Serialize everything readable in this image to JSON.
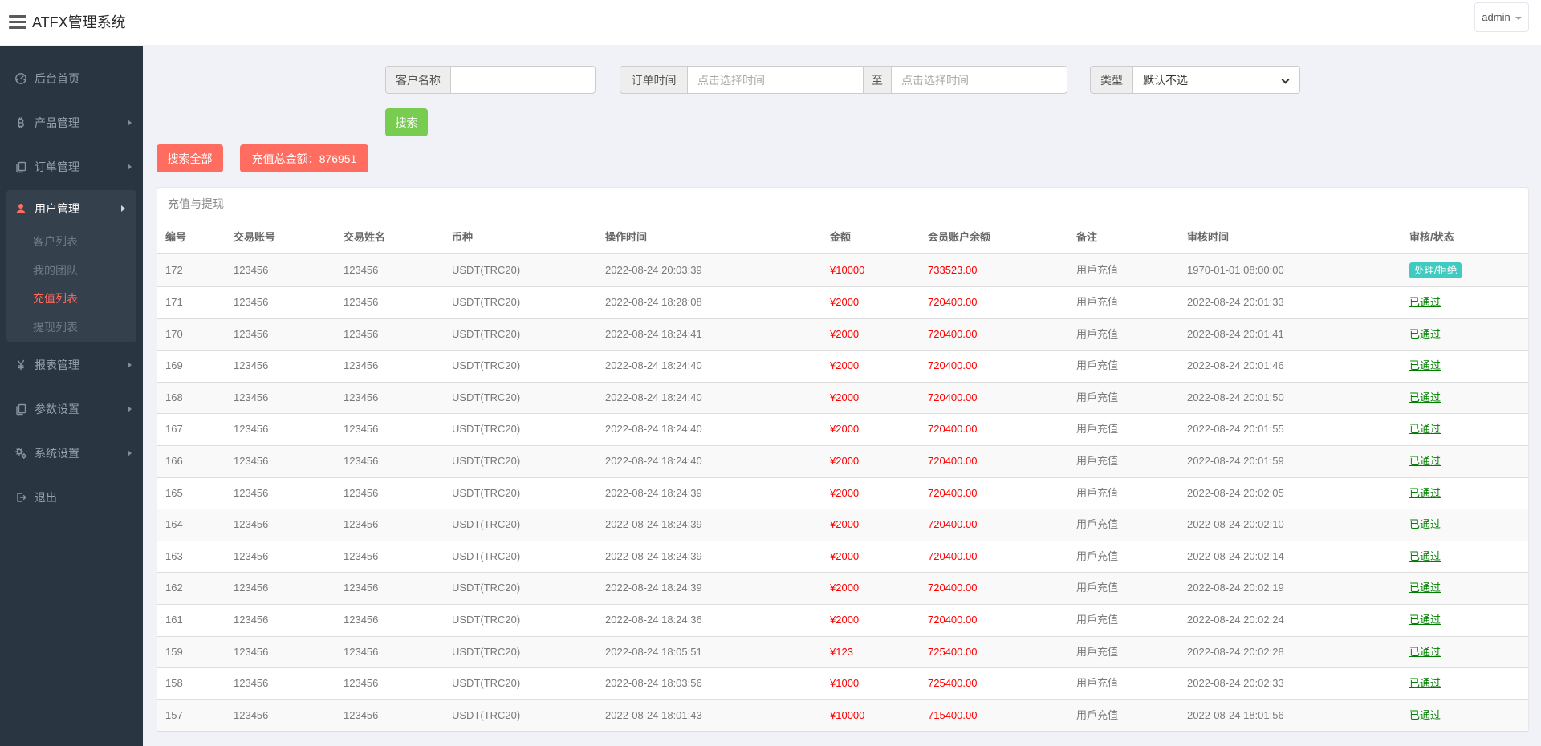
{
  "header": {
    "title": "ATFX管理系统",
    "user_menu": "admin"
  },
  "sidebar": {
    "items": [
      {
        "key": "home",
        "label": "后台首页",
        "icon": "dashboard-icon",
        "arrow": false
      },
      {
        "key": "products",
        "label": "产品管理",
        "icon": "bitcoin-icon",
        "arrow": true
      },
      {
        "key": "orders",
        "label": "订单管理",
        "icon": "orders-icon",
        "arrow": true
      },
      {
        "key": "users",
        "label": "用户管理",
        "icon": "user-icon",
        "arrow": true,
        "active": true,
        "children": [
          {
            "key": "customer-list",
            "label": "客户列表",
            "active": false
          },
          {
            "key": "my-team",
            "label": "我的团队",
            "active": false
          },
          {
            "key": "recharge-list",
            "label": "充值列表",
            "active": true
          },
          {
            "key": "withdraw-list",
            "label": "提现列表",
            "active": false
          }
        ]
      },
      {
        "key": "reports",
        "label": "报表管理",
        "icon": "yen-icon",
        "arrow": true
      },
      {
        "key": "params",
        "label": "参数设置",
        "icon": "params-icon",
        "arrow": true
      },
      {
        "key": "system",
        "label": "系统设置",
        "icon": "gears-icon",
        "arrow": true
      },
      {
        "key": "logout",
        "label": "退出",
        "icon": "logout-icon",
        "arrow": false
      }
    ]
  },
  "filters": {
    "customer_label": "客户名称",
    "order_time_label": "订单时间",
    "time_placeholder": "点击选择时间",
    "to_label": "至",
    "type_label": "类型",
    "type_value": "默认不选",
    "search_button": "搜索",
    "search_all_button": "搜索全部",
    "total_button": "充值总金额：876951"
  },
  "table": {
    "card_title": "充值与提现",
    "columns": [
      "编号",
      "交易账号",
      "交易姓名",
      "币种",
      "操作时间",
      "金额",
      "会员账户余额",
      "备注",
      "审核时间",
      "审核/状态"
    ],
    "pending_label": "处理/拒绝",
    "approved_label": "已通过",
    "rows": [
      [
        "172",
        "123456",
        "123456",
        "USDT(TRC20)",
        "2022-08-24 20:03:39",
        "¥10000",
        "733523.00",
        "用戶充值",
        "1970-01-01 08:00:00",
        "pending"
      ],
      [
        "171",
        "123456",
        "123456",
        "USDT(TRC20)",
        "2022-08-24 18:28:08",
        "¥2000",
        "720400.00",
        "用戶充值",
        "2022-08-24 20:01:33",
        "approved"
      ],
      [
        "170",
        "123456",
        "123456",
        "USDT(TRC20)",
        "2022-08-24 18:24:41",
        "¥2000",
        "720400.00",
        "用戶充值",
        "2022-08-24 20:01:41",
        "approved"
      ],
      [
        "169",
        "123456",
        "123456",
        "USDT(TRC20)",
        "2022-08-24 18:24:40",
        "¥2000",
        "720400.00",
        "用戶充值",
        "2022-08-24 20:01:46",
        "approved"
      ],
      [
        "168",
        "123456",
        "123456",
        "USDT(TRC20)",
        "2022-08-24 18:24:40",
        "¥2000",
        "720400.00",
        "用戶充值",
        "2022-08-24 20:01:50",
        "approved"
      ],
      [
        "167",
        "123456",
        "123456",
        "USDT(TRC20)",
        "2022-08-24 18:24:40",
        "¥2000",
        "720400.00",
        "用戶充值",
        "2022-08-24 20:01:55",
        "approved"
      ],
      [
        "166",
        "123456",
        "123456",
        "USDT(TRC20)",
        "2022-08-24 18:24:40",
        "¥2000",
        "720400.00",
        "用戶充值",
        "2022-08-24 20:01:59",
        "approved"
      ],
      [
        "165",
        "123456",
        "123456",
        "USDT(TRC20)",
        "2022-08-24 18:24:39",
        "¥2000",
        "720400.00",
        "用戶充值",
        "2022-08-24 20:02:05",
        "approved"
      ],
      [
        "164",
        "123456",
        "123456",
        "USDT(TRC20)",
        "2022-08-24 18:24:39",
        "¥2000",
        "720400.00",
        "用戶充值",
        "2022-08-24 20:02:10",
        "approved"
      ],
      [
        "163",
        "123456",
        "123456",
        "USDT(TRC20)",
        "2022-08-24 18:24:39",
        "¥2000",
        "720400.00",
        "用戶充值",
        "2022-08-24 20:02:14",
        "approved"
      ],
      [
        "162",
        "123456",
        "123456",
        "USDT(TRC20)",
        "2022-08-24 18:24:39",
        "¥2000",
        "720400.00",
        "用戶充值",
        "2022-08-24 20:02:19",
        "approved"
      ],
      [
        "161",
        "123456",
        "123456",
        "USDT(TRC20)",
        "2022-08-24 18:24:36",
        "¥2000",
        "720400.00",
        "用戶充值",
        "2022-08-24 20:02:24",
        "approved"
      ],
      [
        "159",
        "123456",
        "123456",
        "USDT(TRC20)",
        "2022-08-24 18:05:51",
        "¥123",
        "725400.00",
        "用戶充值",
        "2022-08-24 20:02:28",
        "approved"
      ],
      [
        "158",
        "123456",
        "123456",
        "USDT(TRC20)",
        "2022-08-24 18:03:56",
        "¥1000",
        "725400.00",
        "用戶充值",
        "2022-08-24 20:02:33",
        "approved"
      ],
      [
        "157",
        "123456",
        "123456",
        "USDT(TRC20)",
        "2022-08-24 18:01:43",
        "¥10000",
        "715400.00",
        "用戶充值",
        "2022-08-24 18:01:56",
        "approved"
      ]
    ]
  }
}
